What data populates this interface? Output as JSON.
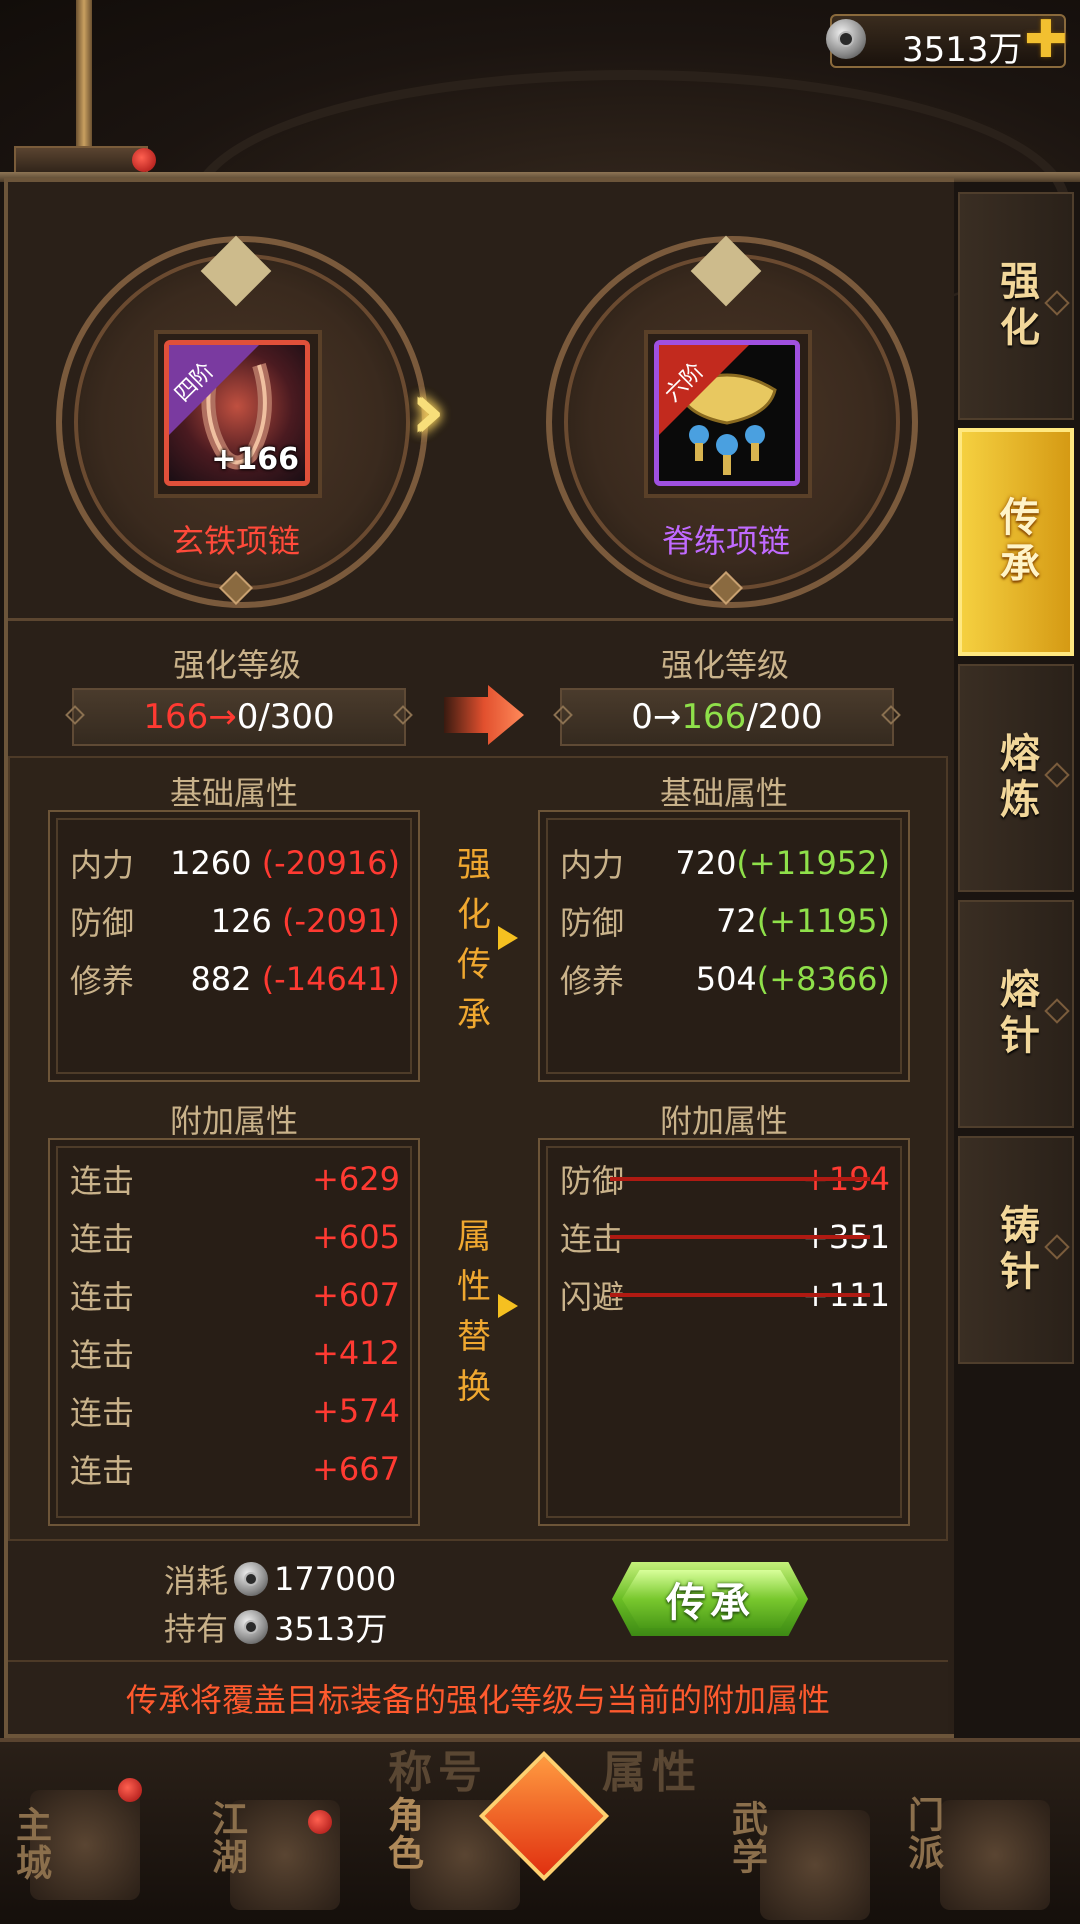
{
  "header": {
    "currency_amount": "3513万",
    "plus_icon": "plus-icon",
    "coin_icon": "silver-coin-icon"
  },
  "source_item": {
    "tier": "四阶",
    "enhance_badge": "+166",
    "name": "玄铁项链",
    "name_color": "#ff4a3a"
  },
  "target_item": {
    "tier": "六阶",
    "name": "脊练项链",
    "name_color": "#c06aff"
  },
  "enhance_level": {
    "left_title": "强化等级",
    "left_from": "166→",
    "left_to": " 0/300",
    "right_title": "强化等级",
    "right_from": "0→ ",
    "right_mid": "166",
    "right_to": "/200"
  },
  "base_attrs": {
    "left_title": "基础属性",
    "right_title": "基础属性",
    "left": [
      {
        "label": "内力",
        "value": "1260 ",
        "delta": "(-20916)"
      },
      {
        "label": "防御",
        "value": "126 ",
        "delta": "(-2091)"
      },
      {
        "label": "修养",
        "value": "882 ",
        "delta": "(-14641)"
      }
    ],
    "middle_label": [
      "强",
      "化",
      "传",
      "承"
    ],
    "right": [
      {
        "label": "内力",
        "value": "720",
        "delta": "(+11952)"
      },
      {
        "label": "防御",
        "value": "72",
        "delta": "(+1195)"
      },
      {
        "label": "修养",
        "value": "504",
        "delta": "(+8366)"
      }
    ]
  },
  "extra_attrs": {
    "left_title": "附加属性",
    "right_title": "附加属性",
    "left": [
      {
        "label": "连击",
        "value": "+629"
      },
      {
        "label": "连击",
        "value": "+605"
      },
      {
        "label": "连击",
        "value": "+607"
      },
      {
        "label": "连击",
        "value": "+412"
      },
      {
        "label": "连击",
        "value": "+574"
      },
      {
        "label": "连击",
        "value": "+667"
      }
    ],
    "middle_label": [
      "属",
      "性",
      "替",
      "换"
    ],
    "right": [
      {
        "label": "防御",
        "value": "+194",
        "value_color": "#ff3a32"
      },
      {
        "label": "连击",
        "value": "+351",
        "value_color": "#ffffff"
      },
      {
        "label": "闪避",
        "value": "+111",
        "value_color": "#ffffff"
      }
    ]
  },
  "cost": {
    "consume_label": "消耗",
    "consume_value": "177000",
    "own_label": "持有",
    "own_value": "3513万"
  },
  "action_button": {
    "label": "传承"
  },
  "notice": "传承将覆盖目标装备的强化等级与当前的附加属性",
  "side_tabs": [
    {
      "label": "强化",
      "active": false
    },
    {
      "label": "传承",
      "active": true
    },
    {
      "label": "熔炼",
      "active": false
    },
    {
      "label": "熔针",
      "active": false
    },
    {
      "label": "铸针",
      "active": false
    }
  ],
  "bottom_nav": {
    "faded_labels": [
      "称号",
      "属性"
    ],
    "items": [
      "主城",
      "江湖",
      "角色",
      "武学",
      "门派"
    ]
  }
}
